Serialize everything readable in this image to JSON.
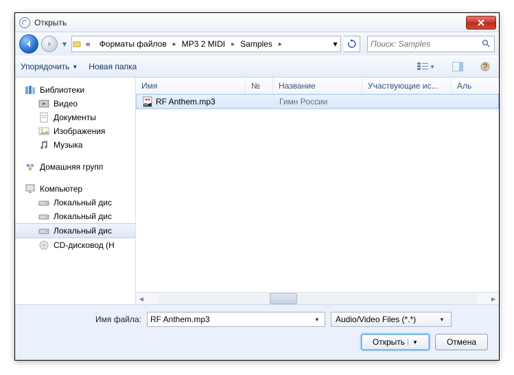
{
  "window": {
    "title": "Открыть"
  },
  "breadcrumbs": {
    "seg0": "«",
    "seg1": "Форматы файлов",
    "seg2": "MP3 2 MIDI",
    "seg3": "Samples"
  },
  "search": {
    "placeholder": "Поиск: Samples"
  },
  "toolbar": {
    "organize": "Упорядочить",
    "newfolder": "Новая папка"
  },
  "sidebar": {
    "libraries": "Библиотеки",
    "video": "Видео",
    "documents": "Документы",
    "images": "Изображения",
    "music": "Музыка",
    "homegroup": "Домашняя групп",
    "computer": "Компьютер",
    "localdisk1": "Локальный дис",
    "localdisk2": "Локальный дис",
    "localdisk3": "Локальный дис",
    "cddrive": "CD-дисковод (H"
  },
  "columns": {
    "name": "Имя",
    "number": "№",
    "title": "Название",
    "artists": "Участвующие ис...",
    "album": "Аль"
  },
  "files": [
    {
      "name": "RF Anthem.mp3",
      "number": "",
      "title": "Гимн России",
      "artists": "",
      "album": ""
    }
  ],
  "bottom": {
    "fname_label": "Имя файла:",
    "fname_value": "RF Anthem.mp3",
    "filter": "Audio/Video Files (*.*)",
    "open": "Открыть",
    "cancel": "Отмена"
  }
}
